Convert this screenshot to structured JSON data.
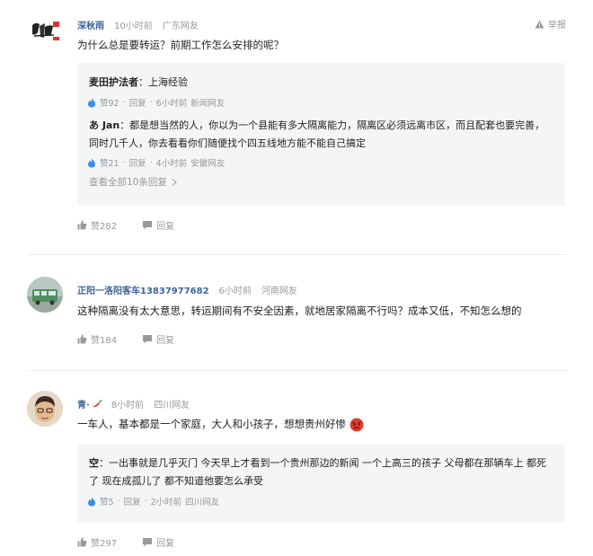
{
  "comments": [
    {
      "username": "深秋雨",
      "time": "10小时前",
      "location": "广东网友",
      "report_label": "举报",
      "content": "为什么总是要转运？前期工作怎么安排的呢？",
      "replies": [
        {
          "user": "麦田护法者",
          "text": "：上海经验",
          "likes": "赞92",
          "reply_label": "回复",
          "time": "6小时前",
          "location": "新闻网友"
        },
        {
          "user": "あ Jan",
          "text": "：都是想当然的人，你以为一个县能有多大隔离能力，隔离区必须远离市区，而且配套也要完善，同时几千人，你去看看你们随便找个四五线地方能不能自己搞定",
          "likes": "赞21",
          "reply_label": "回复",
          "time": "4小时前",
          "location": "安徽网友"
        }
      ],
      "view_all": "查看全部10条回复",
      "likes": "赞282",
      "reply_label": "回复"
    },
    {
      "username": "正阳一洛阳客车13837977682",
      "time": "6小时前",
      "location": "河南网友",
      "content": "这种隔离没有太大意思，转运期间有不安全因素，就地居家隔离不行吗？成本又低，不知怎么想的",
      "likes": "赞184",
      "reply_label": "回复"
    },
    {
      "username": "青·",
      "time": "8小时前",
      "location": "四川网友",
      "content": "一车人，基本都是一个家庭，大人和小孩子，想想贵州好惨",
      "replies": [
        {
          "user": "空",
          "text": "：一出事就是几乎灭门 今天早上才看到一个贵州那边的新闻 一个上高三的孩子 父母都在那辆车上 都死了 现在成孤儿了 都不知道他要怎么承受",
          "likes": "赞5",
          "reply_label": "回复",
          "time": "2小时前",
          "location": "四川网友"
        }
      ],
      "likes": "赞297",
      "reply_label": "回复"
    }
  ],
  "colors": {
    "username": "#406599",
    "meta": "#999999",
    "reply_bg": "#f4f5f6",
    "like_icon": "#3b8ee8"
  },
  "icons": [
    "warning-icon",
    "thumb-up-icon",
    "speech-bubble-icon",
    "chili-pepper-icon",
    "angry-face-icon"
  ]
}
